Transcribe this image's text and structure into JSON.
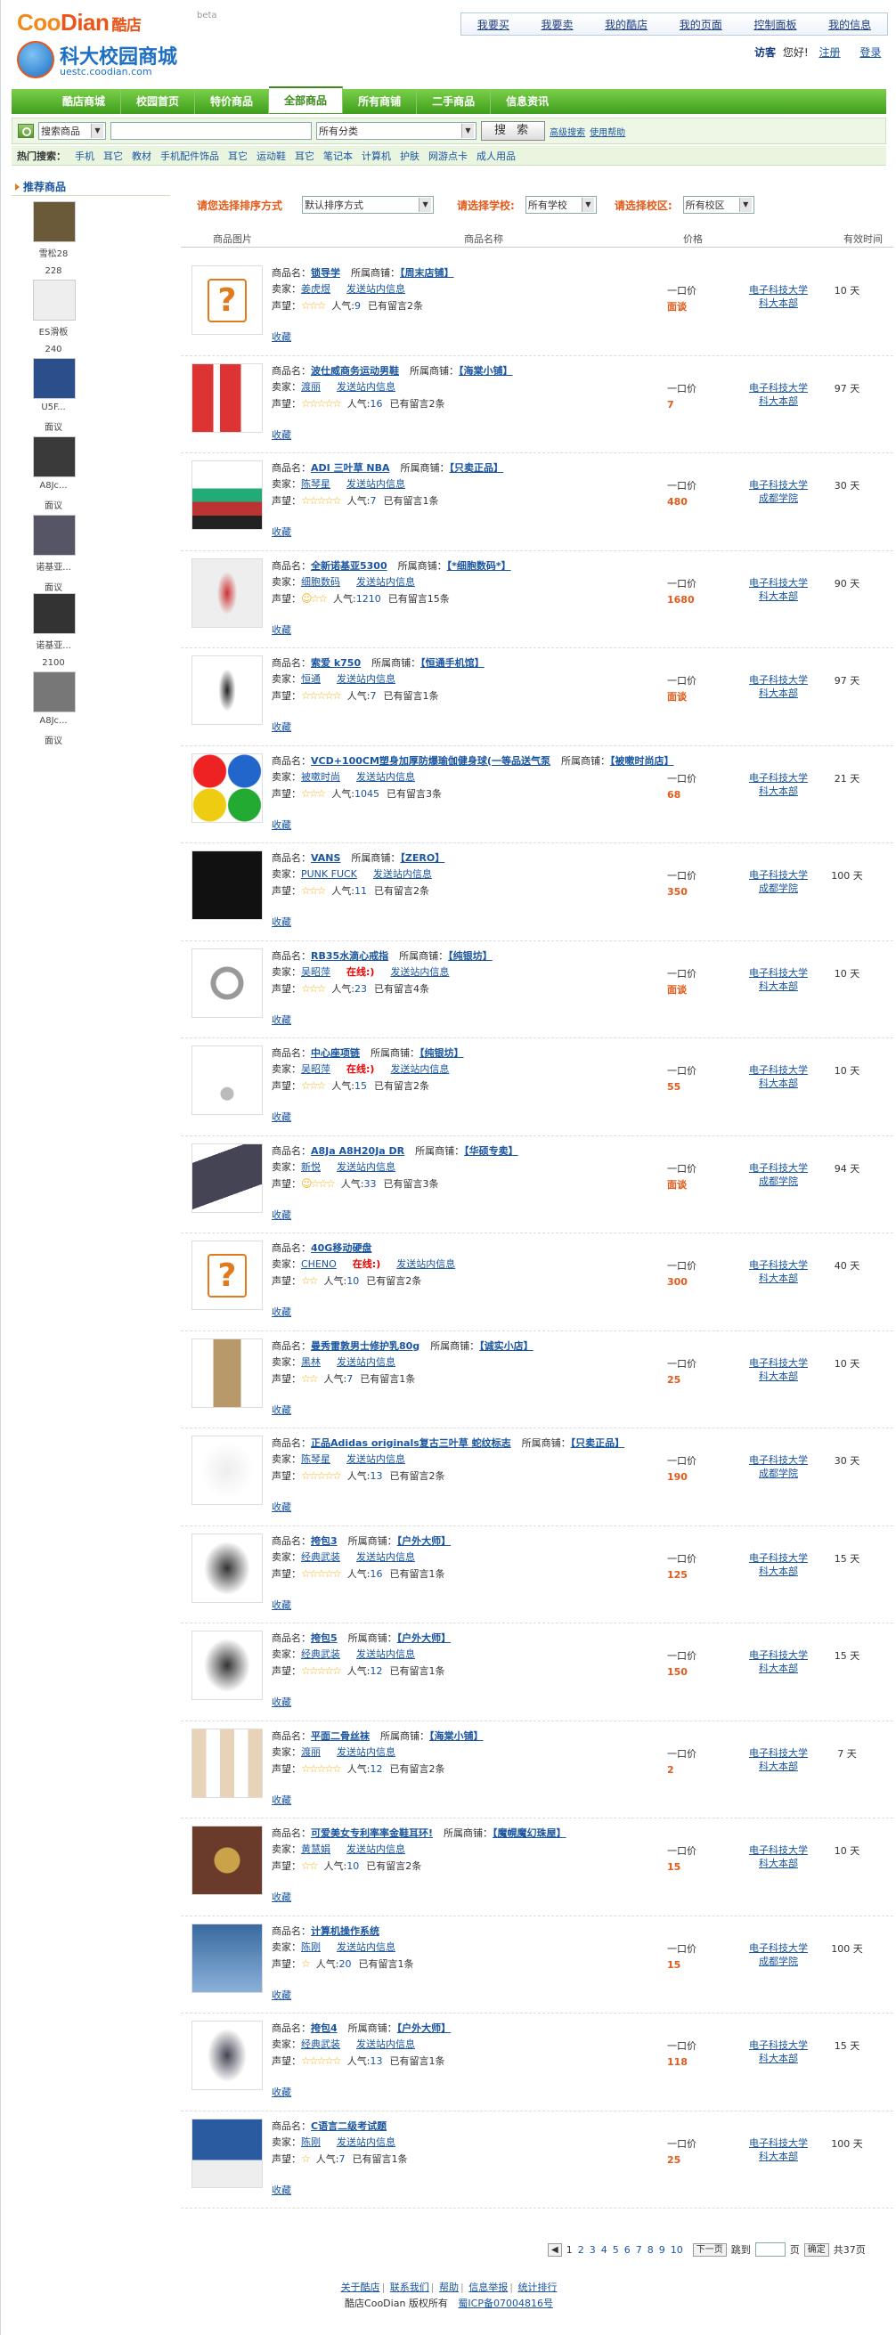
{
  "logo": {
    "brand1": "Coo",
    "brand2": "Dian",
    "cn": "酷店",
    "beta": "beta",
    "subtitle": "科大校园商城",
    "url": "uestc.coodian.com"
  },
  "topnav": [
    "我要买",
    "我要卖",
    "我的酷店",
    "我的页面",
    "控制面板",
    "我的信息"
  ],
  "user": {
    "visitor": "访客",
    "greet": "您好!",
    "register": "注册",
    "login": "登录"
  },
  "mainnav": [
    "酷店商城",
    "校园首页",
    "特价商品",
    "全部商品",
    "所有商铺",
    "二手商品",
    "信息资讯"
  ],
  "search": {
    "type": "搜索商品",
    "category": "所有分类",
    "button": "搜 索",
    "adv": "高级搜索",
    "help": "使用帮助"
  },
  "hot": {
    "label": "热门搜索：",
    "items": [
      "手机",
      "耳它",
      "教材",
      "手机配件饰品",
      "耳它",
      "运动鞋",
      "耳它",
      "笔记本",
      "计算机",
      "护肤",
      "网游点卡",
      "成人用品"
    ]
  },
  "sidebar": {
    "title": "推荐商品",
    "items": [
      {
        "name": "雪松28",
        "price": "228"
      },
      {
        "name": "ES滑板",
        "price": "240"
      },
      {
        "name": "U5F...",
        "price": "面议"
      },
      {
        "name": "A8Jc...",
        "price": "面议"
      },
      {
        "name": "诺基亚...",
        "price": "面议"
      },
      {
        "name": "诺基亚...",
        "price": "2100"
      },
      {
        "name": "A8Jc...",
        "price": "面议"
      }
    ]
  },
  "filters": {
    "sort_label": "请您选择排序方式",
    "sort_value": "默认排序方式",
    "school_label": "请选择学校:",
    "school_value": "所有学校",
    "campus_label": "请选择校区:",
    "campus_value": "所有校区"
  },
  "thead": {
    "img": "商品图片",
    "name": "商品名称",
    "price": "价格",
    "time": "有效时间"
  },
  "labels": {
    "name": "商品名：",
    "shop": "所属商铺：",
    "seller": "卖家：",
    "rep": "声望：",
    "hot": "人气:",
    "msg": "发送站内信息",
    "fav": "收藏",
    "onepr": "一口价",
    "online": "在线:)"
  },
  "products": [
    {
      "name": "锁导学",
      "shop": "【周末店铺】",
      "seller": "姜虎煜",
      "stars": "☆☆☆",
      "hot": "9",
      "reviews": "已有留言2条",
      "price": "面谈",
      "school1": "电子科技大学",
      "school2": "科大本部",
      "days": "10 天",
      "img": "placeholder",
      "online": false
    },
    {
      "name": "波仕威商务运动男鞋",
      "shop": "【海棠小铺】",
      "seller": "渡丽",
      "stars": "☆☆☆☆☆",
      "hot": "16",
      "reviews": "已有留言2条",
      "price": "7",
      "school1": "电子科技大学",
      "school2": "科大本部",
      "days": "97 天",
      "img": "shoes",
      "online": false
    },
    {
      "name": "ADI 三叶草  NBA",
      "shop": "【只卖正品】",
      "seller": "陈琴星",
      "stars": "☆☆☆☆☆",
      "hot": "7",
      "reviews": "已有留言1条",
      "price": "480",
      "school1": "电子科技大学",
      "school2": "成都学院",
      "days": "30 天",
      "img": "nba",
      "online": false
    },
    {
      "name": "全新诺基亚5300",
      "shop": "【*细胞数码*】",
      "seller": "细胞数码",
      "stars": "☺☆☆",
      "hot": "1210",
      "reviews": "已有留言15条",
      "price": "1680",
      "school1": "电子科技大学",
      "school2": "科大本部",
      "days": "90 天",
      "img": "phone",
      "online": false
    },
    {
      "name": "索爱  k750",
      "shop": "【恒通手机馆】",
      "seller": "恒通",
      "stars": "☆☆☆☆☆",
      "hot": "7",
      "reviews": "已有留言1条",
      "price": "面谈",
      "school1": "电子科技大学",
      "school2": "科大本部",
      "days": "97 天",
      "img": "phone2",
      "online": false
    },
    {
      "name": "VCD+100CM塑身加厚防爆瑜伽健身球(一等品送气泵",
      "shop": "【被嗽时尚店】",
      "seller": "被嗽时尚",
      "stars": "☆☆☆",
      "hot": "1045",
      "reviews": "已有留言3条",
      "price": "68",
      "school1": "电子科技大学",
      "school2": "科大本部",
      "days": "21 天",
      "img": "balls",
      "online": false
    },
    {
      "name": "VANS",
      "shop": "【ZERO】",
      "seller": "PUNK FUCK",
      "stars": "☆☆☆",
      "hot": "11",
      "reviews": "已有留言2条",
      "price": "350",
      "school1": "电子科技大学",
      "school2": "成都学院",
      "days": "100 天",
      "img": "vans",
      "online": false
    },
    {
      "name": "RB35水滴心戒指",
      "shop": "【纯银坊】",
      "seller": "吴昭萍",
      "stars": "☆☆☆",
      "hot": "23",
      "reviews": "已有留言4条",
      "price": "面谈",
      "school1": "电子科技大学",
      "school2": "科大本部",
      "days": "10 天",
      "img": "ring",
      "online": true
    },
    {
      "name": "中心座项链",
      "shop": "【纯银坊】",
      "seller": "吴昭萍",
      "stars": "☆☆☆",
      "hot": "15",
      "reviews": "已有留言2条",
      "price": "55",
      "school1": "电子科技大学",
      "school2": "科大本部",
      "days": "10 天",
      "img": "necklace",
      "online": true
    },
    {
      "name": "A8Ja A8H20Ja DR",
      "shop": "【华硕专卖】",
      "seller": "新悦",
      "stars": "☺☆☆☆",
      "hot": "33",
      "reviews": "已有留言3条",
      "price": "面谈",
      "school1": "电子科技大学",
      "school2": "成都学院",
      "days": "94 天",
      "img": "laptop",
      "online": false
    },
    {
      "name": "40G移动硬盘",
      "shop": "",
      "seller": "CHENO",
      "stars": "☆☆",
      "hot": "10",
      "reviews": "已有留言2条",
      "price": "300",
      "school1": "电子科技大学",
      "school2": "科大本部",
      "days": "40 天",
      "img": "placeholder",
      "online": true
    },
    {
      "name": "曼秀雷敦男士修护乳80g",
      "shop": "【诚实小店】",
      "seller": "黑林",
      "stars": "☆☆",
      "hot": "7",
      "reviews": "已有留言1条",
      "price": "25",
      "school1": "电子科技大学",
      "school2": "科大本部",
      "days": "10 天",
      "img": "tube",
      "online": false
    },
    {
      "name": "正品Adidas originals复古三叶草  蛇纹标志",
      "shop": "【只卖正品】",
      "seller": "陈琴星",
      "stars": "☆☆☆☆☆",
      "hot": "13",
      "reviews": "已有留言2条",
      "price": "190",
      "school1": "电子科技大学",
      "school2": "成都学院",
      "days": "30 天",
      "img": "tshirt",
      "online": false
    },
    {
      "name": "挎包3",
      "shop": "【户外大师】",
      "seller": "经典武装",
      "stars": "☆☆☆☆☆",
      "hot": "16",
      "reviews": "已有留言1条",
      "price": "125",
      "school1": "电子科技大学",
      "school2": "科大本部",
      "days": "15 天",
      "img": "bag",
      "online": false
    },
    {
      "name": "挎包5",
      "shop": "【户外大师】",
      "seller": "经典武装",
      "stars": "☆☆☆☆☆",
      "hot": "12",
      "reviews": "已有留言1条",
      "price": "150",
      "school1": "电子科技大学",
      "school2": "科大本部",
      "days": "15 天",
      "img": "bag",
      "online": false
    },
    {
      "name": "平面二骨丝袜",
      "shop": "【海棠小铺】",
      "seller": "渡丽",
      "stars": "☆☆☆☆☆",
      "hot": "12",
      "reviews": "已有留言2条",
      "price": "2",
      "school1": "电子科技大学",
      "school2": "科大本部",
      "days": "7 天",
      "img": "socks",
      "online": false
    },
    {
      "name": "可爱美女专利率率金鞋耳环!",
      "shop": "【魔幌魔幻珠屋】",
      "seller": "黄慧娟",
      "stars": "☆☆",
      "hot": "10",
      "reviews": "已有留言2条",
      "price": "15",
      "school1": "电子科技大学",
      "school2": "科大本部",
      "days": "10 天",
      "img": "earring",
      "online": false
    },
    {
      "name": "计算机操作系统",
      "shop": "",
      "seller": "陈刚",
      "stars": "☆",
      "hot": "20",
      "reviews": "已有留言1条",
      "price": "15",
      "school1": "电子科技大学",
      "school2": "成都学院",
      "days": "100 天",
      "img": "book",
      "online": false
    },
    {
      "name": "挎包4",
      "shop": "【户外大师】",
      "seller": "经典武装",
      "stars": "☆☆☆☆☆",
      "hot": "13",
      "reviews": "已有留言1条",
      "price": "118",
      "school1": "电子科技大学",
      "school2": "科大本部",
      "days": "15 天",
      "img": "bag2",
      "online": false
    },
    {
      "name": "C语言二级考试题",
      "shop": "",
      "seller": "陈刚",
      "stars": "☆",
      "hot": "7",
      "reviews": "已有留言1条",
      "price": "25",
      "school1": "电子科技大学",
      "school2": "科大本部",
      "days": "100 天",
      "img": "book2",
      "online": false
    }
  ],
  "pager": {
    "pages": [
      "1",
      "2",
      "3",
      "4",
      "5",
      "6",
      "7",
      "8",
      "9",
      "10"
    ],
    "next": "下一页",
    "goto": "跳到",
    "unit": "页",
    "ok": "确定",
    "total": "共37页"
  },
  "footer": {
    "links": [
      "关于酷店",
      "联系我们",
      "帮助",
      "信息举报",
      "统计排行"
    ],
    "copyright": "酷店CooDian   版权所有",
    "icp": "蜀ICP备07004816号"
  },
  "colors": {
    "green": "#4aad24",
    "orange": "#e35a1a",
    "link": "#1a55a0"
  }
}
